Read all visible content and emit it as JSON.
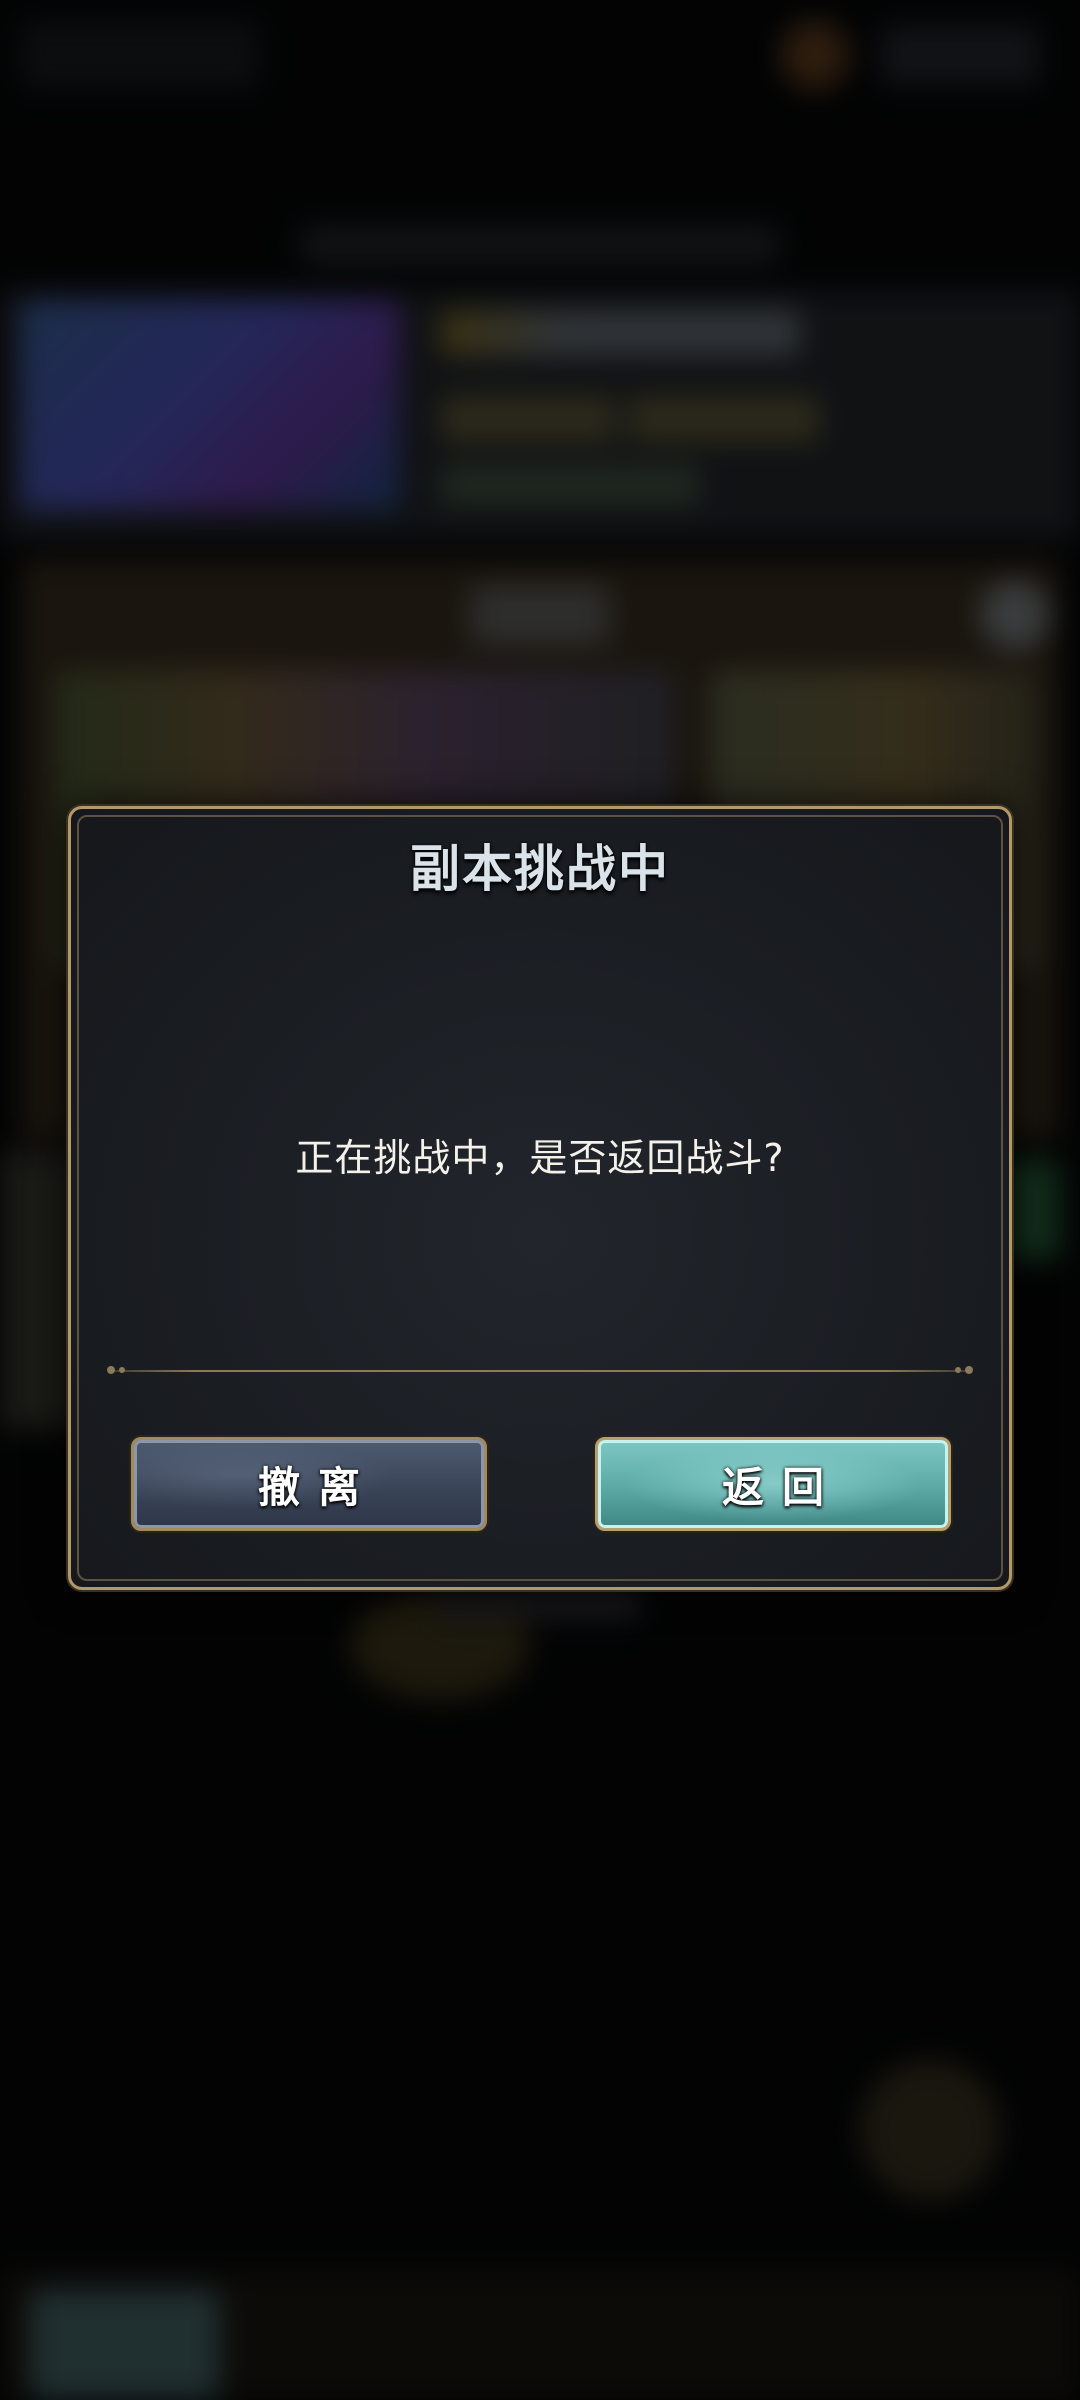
{
  "dialog": {
    "title": "副本挑战中",
    "message": "正在挑战中，是否返回战斗?",
    "buttons": {
      "leave_label": "撤离",
      "return_label": "返回"
    }
  },
  "colors": {
    "dialog_border": "#b39868",
    "title_text": "#dbe3ea",
    "leave_button": "#3a4458",
    "return_button": "#5aa9a6"
  }
}
